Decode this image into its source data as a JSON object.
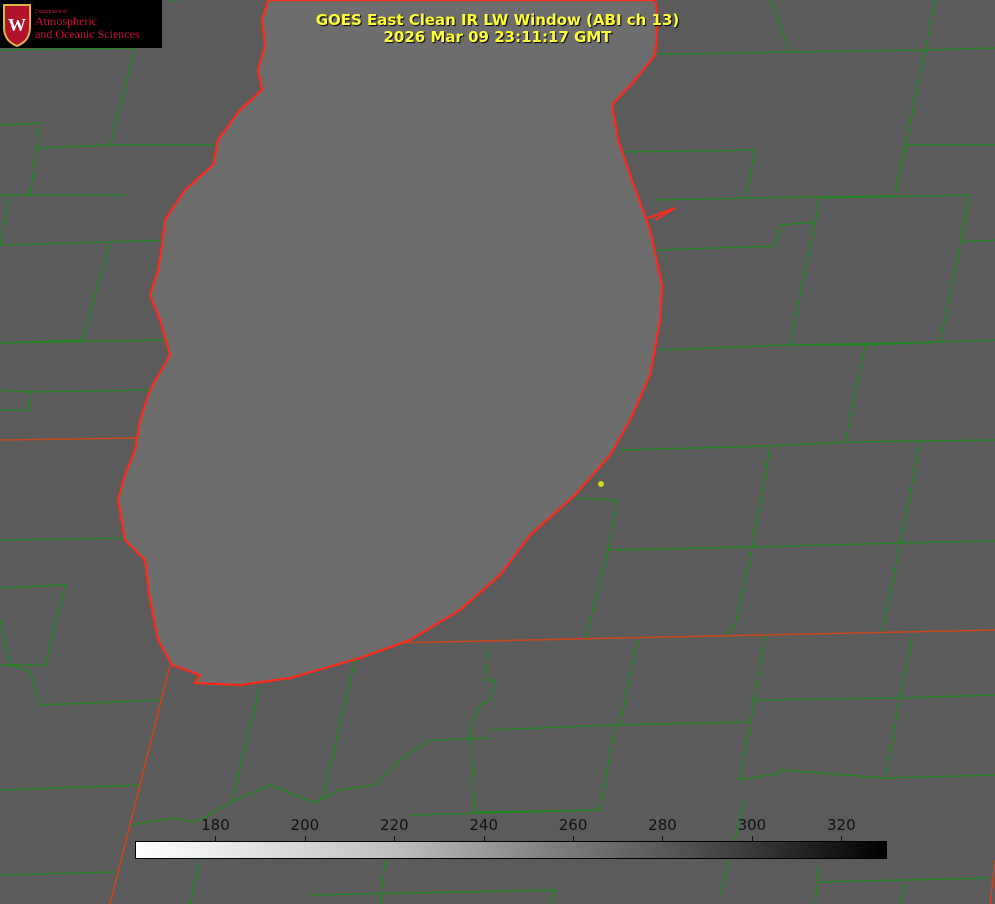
{
  "title": {
    "line1": "GOES East Clean IR LW Window (ABI ch 13)",
    "line2": "2026 Mar 09 23:11:17 GMT"
  },
  "logo": {
    "dept": "Department of",
    "line1": "Atmospheric",
    "line2": "and Oceanic Sciences",
    "emblem": "W"
  },
  "colorbar": {
    "min": 162,
    "max": 330,
    "ticks": [
      "180",
      "200",
      "220",
      "240",
      "260",
      "280",
      "300",
      "320"
    ],
    "tick_values": [
      180,
      200,
      220,
      240,
      260,
      280,
      300,
      320
    ],
    "colormap": "white-to-black"
  },
  "colors": {
    "background": "#5b5b5b",
    "lake": "#6d6d6d",
    "coastline": "#ff2a1a",
    "county": "#1f8a1f",
    "title": "#ffff33",
    "marker": "#d4d41a"
  }
}
